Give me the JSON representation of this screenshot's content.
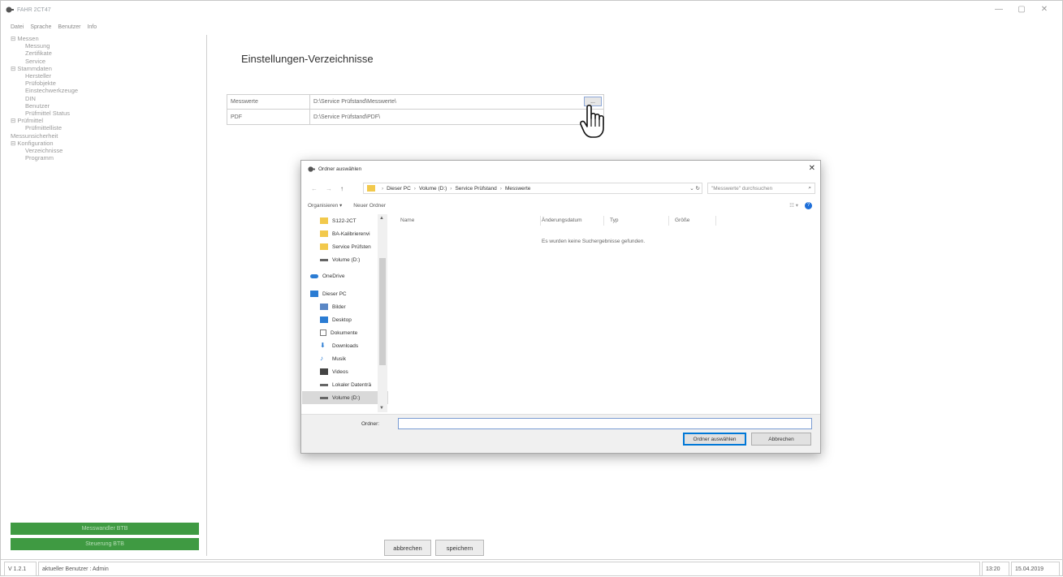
{
  "window": {
    "title": "FAHR 2CT47",
    "controls": [
      "—",
      "▢",
      "✕"
    ]
  },
  "menu": [
    "Datei",
    "Sprache",
    "Benutzer",
    "Info"
  ],
  "tree": [
    {
      "label": "⊟ Messen",
      "level": 0
    },
    {
      "label": "Messung",
      "level": 1
    },
    {
      "label": "Zertifikate",
      "level": 1
    },
    {
      "label": "Service",
      "level": 1
    },
    {
      "label": "⊟ Stammdaten",
      "level": 0
    },
    {
      "label": "Hersteller",
      "level": 1
    },
    {
      "label": "Prüfobjekte",
      "level": 1
    },
    {
      "label": "Einstechwerkzeuge",
      "level": 1
    },
    {
      "label": "DIN",
      "level": 1
    },
    {
      "label": "Benutzer",
      "level": 1
    },
    {
      "label": "Prüfmittel Status",
      "level": 1
    },
    {
      "label": "⊟ Prüfmittel",
      "level": 0
    },
    {
      "label": "Prüfmittelliste",
      "level": 1
    },
    {
      "label": "Messunsicherheit",
      "level": 0
    },
    {
      "label": "⊟ Konfiguration",
      "level": 0
    },
    {
      "label": "Verzeichnisse",
      "level": 1
    },
    {
      "label": "Programm",
      "level": 1
    }
  ],
  "green_buttons": [
    "Messwandler BTB",
    "Steuerung BTB"
  ],
  "main": {
    "title": "Einstellungen-Verzeichnisse",
    "rows": [
      {
        "label": "Messwerte",
        "value": "D:\\Service Prüfstand\\Messwerte\\"
      },
      {
        "label": "PDF",
        "value": "D:\\Service Prüfstand\\PDF\\"
      }
    ],
    "browse_label": "...",
    "cancel_label": "abbrechen",
    "save_label": "speichern"
  },
  "status": {
    "version": "V 1.2.1",
    "user": "aktueller Benutzer : Admin",
    "time": "13:20",
    "date": "15.04.2019"
  },
  "dialog": {
    "title": "Ordner auswählen",
    "close": "✕",
    "nav_back": "←",
    "nav_forward": "→",
    "nav_up": "↑",
    "path": [
      "Dieser PC",
      "Volume (D:)",
      "Service Prüfstand",
      "Messwerte"
    ],
    "path_controls": "⌄  ↻",
    "search_placeholder": "\"Messwerte\" durchsuchen",
    "organize": "Organisieren ▾",
    "new_folder": "Neuer Ordner",
    "view_icon": "☷ ▾",
    "help_icon": "?",
    "nav_items": [
      {
        "label": "S122-2CT",
        "icon": "folder-icon",
        "color": "#f2c94c"
      },
      {
        "label": "BA-Kalibrierenvi",
        "icon": "folder-icon",
        "color": "#f2c94c"
      },
      {
        "label": "Service Prüfsten",
        "icon": "folder-icon",
        "color": "#f2c94c"
      },
      {
        "label": "Volume (D:)",
        "icon": "drive-icon",
        "color": "#666666"
      },
      {
        "label": "OneDrive",
        "icon": "cloud-icon",
        "color": "#2b7cd3"
      },
      {
        "label": "Dieser PC",
        "icon": "pc-icon",
        "color": "#2b7cd3"
      },
      {
        "label": "Bilder",
        "icon": "pictures-icon",
        "color": "#5b87c5"
      },
      {
        "label": "Desktop",
        "icon": "desktop-icon",
        "color": "#2b7cd3"
      },
      {
        "label": "Dokumente",
        "icon": "documents-icon",
        "color": "#777777"
      },
      {
        "label": "Downloads",
        "icon": "download-icon",
        "color": "#2b7cd3"
      },
      {
        "label": "Musik",
        "icon": "music-icon",
        "color": "#2b7cd3"
      },
      {
        "label": "Videos",
        "icon": "video-icon",
        "color": "#444444"
      },
      {
        "label": "Lokaler Datenträ",
        "icon": "drive-icon",
        "color": "#666666"
      },
      {
        "label": "Volume (D:)",
        "icon": "drive-icon",
        "color": "#666666",
        "selected": true
      }
    ],
    "columns": [
      "Name",
      "Änderungsdatum",
      "Typ",
      "Größe"
    ],
    "empty_message": "Es wurden keine Suchergebnisse gefunden.",
    "folder_label": "Ordner:",
    "folder_value": "",
    "select_label": "Ordner auswählen",
    "cancel_label": "Abbrechen"
  }
}
